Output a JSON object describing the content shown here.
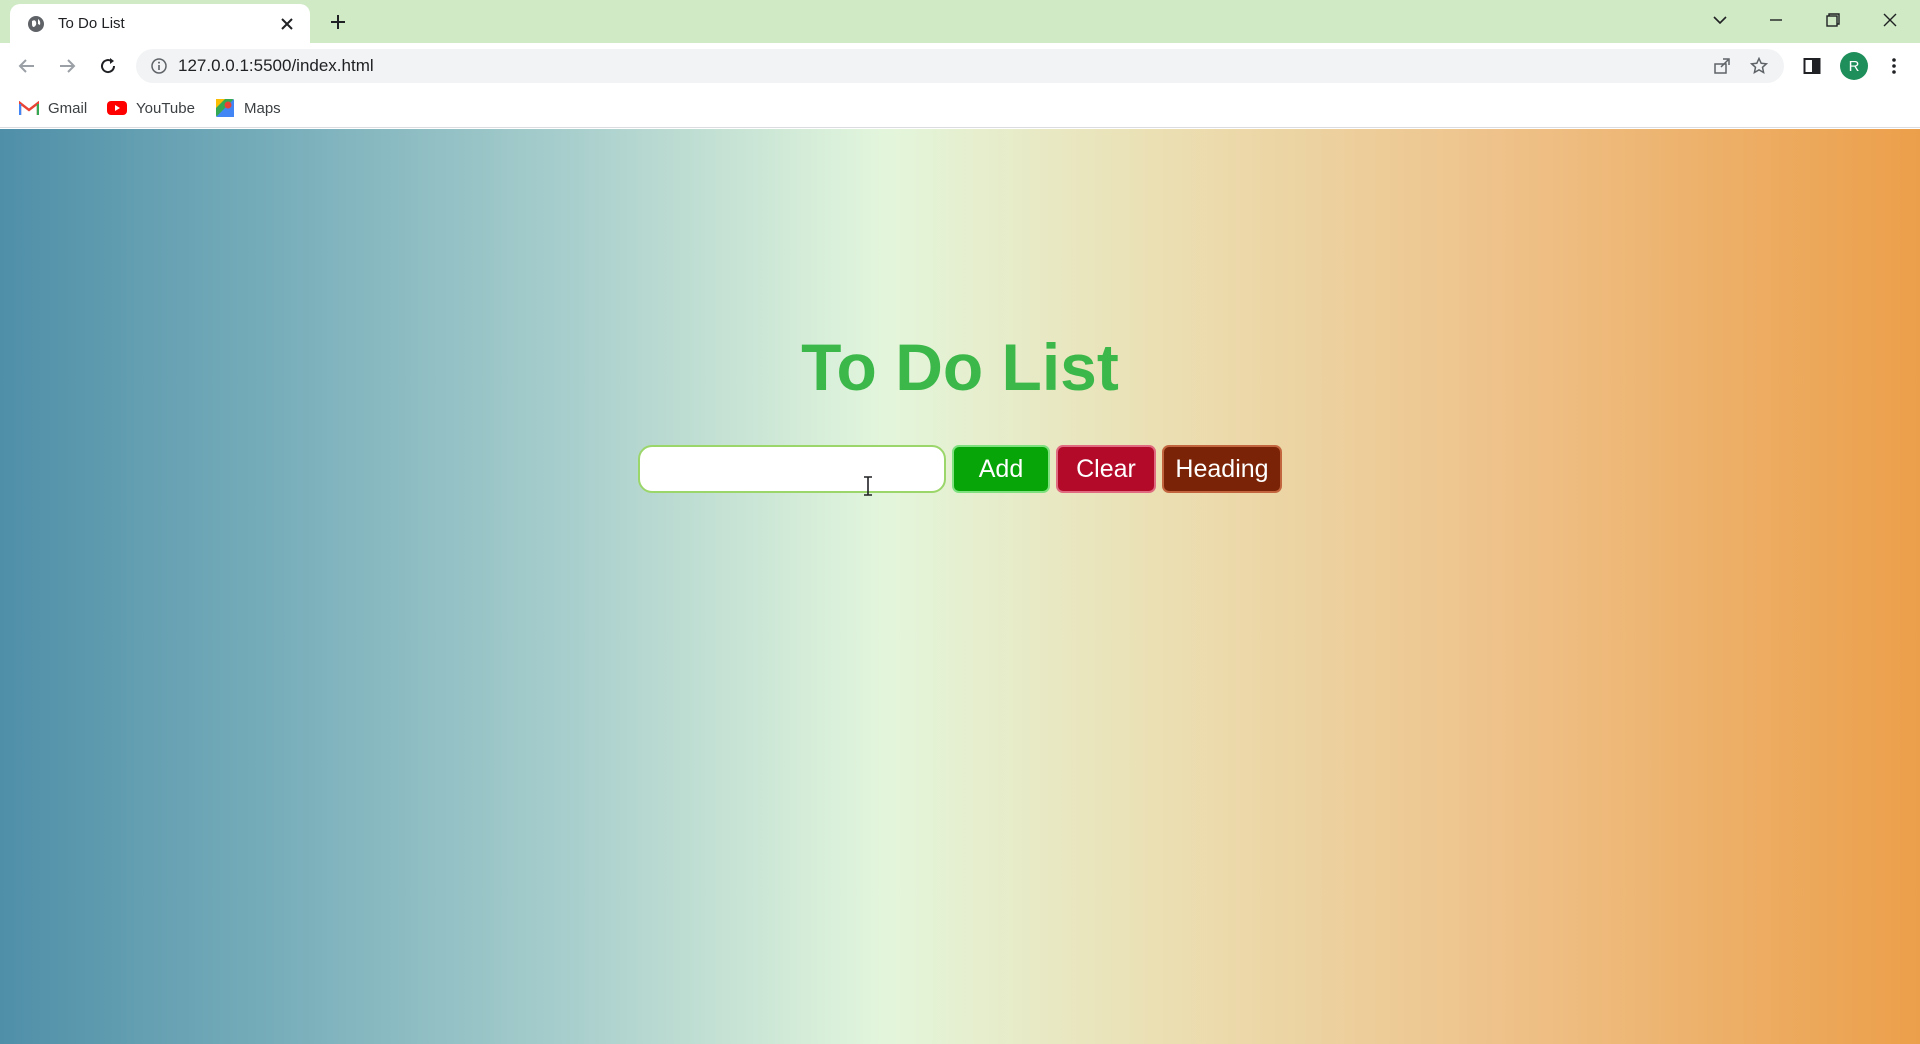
{
  "browser": {
    "tab_title": "To Do List",
    "url": "127.0.0.1:5500/index.html",
    "profile_initial": "R",
    "bookmarks": [
      {
        "label": "Gmail",
        "icon": "gmail-icon"
      },
      {
        "label": "YouTube",
        "icon": "youtube-icon"
      },
      {
        "label": "Maps",
        "icon": "maps-icon"
      }
    ]
  },
  "page": {
    "title": "To Do List",
    "input_value": "",
    "buttons": {
      "add": "Add",
      "clear": "Clear",
      "heading": "Heading"
    }
  },
  "colors": {
    "title_green": "#3cb84a",
    "add_green": "#08a508",
    "clear_red": "#b30a2a",
    "heading_brown": "#7a2306"
  }
}
